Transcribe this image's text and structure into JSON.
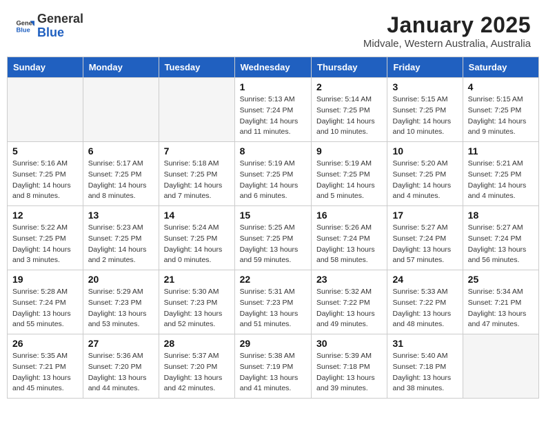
{
  "header": {
    "logo_general": "General",
    "logo_blue": "Blue",
    "month": "January 2025",
    "location": "Midvale, Western Australia, Australia"
  },
  "weekdays": [
    "Sunday",
    "Monday",
    "Tuesday",
    "Wednesday",
    "Thursday",
    "Friday",
    "Saturday"
  ],
  "weeks": [
    [
      {
        "day": "",
        "sunrise": "",
        "sunset": "",
        "daylight": "",
        "empty": true
      },
      {
        "day": "",
        "sunrise": "",
        "sunset": "",
        "daylight": "",
        "empty": true
      },
      {
        "day": "",
        "sunrise": "",
        "sunset": "",
        "daylight": "",
        "empty": true
      },
      {
        "day": "1",
        "sunrise": "Sunrise: 5:13 AM",
        "sunset": "Sunset: 7:24 PM",
        "daylight": "Daylight: 14 hours and 11 minutes.",
        "empty": false
      },
      {
        "day": "2",
        "sunrise": "Sunrise: 5:14 AM",
        "sunset": "Sunset: 7:25 PM",
        "daylight": "Daylight: 14 hours and 10 minutes.",
        "empty": false
      },
      {
        "day": "3",
        "sunrise": "Sunrise: 5:15 AM",
        "sunset": "Sunset: 7:25 PM",
        "daylight": "Daylight: 14 hours and 10 minutes.",
        "empty": false
      },
      {
        "day": "4",
        "sunrise": "Sunrise: 5:15 AM",
        "sunset": "Sunset: 7:25 PM",
        "daylight": "Daylight: 14 hours and 9 minutes.",
        "empty": false
      }
    ],
    [
      {
        "day": "5",
        "sunrise": "Sunrise: 5:16 AM",
        "sunset": "Sunset: 7:25 PM",
        "daylight": "Daylight: 14 hours and 8 minutes.",
        "empty": false
      },
      {
        "day": "6",
        "sunrise": "Sunrise: 5:17 AM",
        "sunset": "Sunset: 7:25 PM",
        "daylight": "Daylight: 14 hours and 8 minutes.",
        "empty": false
      },
      {
        "day": "7",
        "sunrise": "Sunrise: 5:18 AM",
        "sunset": "Sunset: 7:25 PM",
        "daylight": "Daylight: 14 hours and 7 minutes.",
        "empty": false
      },
      {
        "day": "8",
        "sunrise": "Sunrise: 5:19 AM",
        "sunset": "Sunset: 7:25 PM",
        "daylight": "Daylight: 14 hours and 6 minutes.",
        "empty": false
      },
      {
        "day": "9",
        "sunrise": "Sunrise: 5:19 AM",
        "sunset": "Sunset: 7:25 PM",
        "daylight": "Daylight: 14 hours and 5 minutes.",
        "empty": false
      },
      {
        "day": "10",
        "sunrise": "Sunrise: 5:20 AM",
        "sunset": "Sunset: 7:25 PM",
        "daylight": "Daylight: 14 hours and 4 minutes.",
        "empty": false
      },
      {
        "day": "11",
        "sunrise": "Sunrise: 5:21 AM",
        "sunset": "Sunset: 7:25 PM",
        "daylight": "Daylight: 14 hours and 4 minutes.",
        "empty": false
      }
    ],
    [
      {
        "day": "12",
        "sunrise": "Sunrise: 5:22 AM",
        "sunset": "Sunset: 7:25 PM",
        "daylight": "Daylight: 14 hours and 3 minutes.",
        "empty": false
      },
      {
        "day": "13",
        "sunrise": "Sunrise: 5:23 AM",
        "sunset": "Sunset: 7:25 PM",
        "daylight": "Daylight: 14 hours and 2 minutes.",
        "empty": false
      },
      {
        "day": "14",
        "sunrise": "Sunrise: 5:24 AM",
        "sunset": "Sunset: 7:25 PM",
        "daylight": "Daylight: 14 hours and 0 minutes.",
        "empty": false
      },
      {
        "day": "15",
        "sunrise": "Sunrise: 5:25 AM",
        "sunset": "Sunset: 7:25 PM",
        "daylight": "Daylight: 13 hours and 59 minutes.",
        "empty": false
      },
      {
        "day": "16",
        "sunrise": "Sunrise: 5:26 AM",
        "sunset": "Sunset: 7:24 PM",
        "daylight": "Daylight: 13 hours and 58 minutes.",
        "empty": false
      },
      {
        "day": "17",
        "sunrise": "Sunrise: 5:27 AM",
        "sunset": "Sunset: 7:24 PM",
        "daylight": "Daylight: 13 hours and 57 minutes.",
        "empty": false
      },
      {
        "day": "18",
        "sunrise": "Sunrise: 5:27 AM",
        "sunset": "Sunset: 7:24 PM",
        "daylight": "Daylight: 13 hours and 56 minutes.",
        "empty": false
      }
    ],
    [
      {
        "day": "19",
        "sunrise": "Sunrise: 5:28 AM",
        "sunset": "Sunset: 7:24 PM",
        "daylight": "Daylight: 13 hours and 55 minutes.",
        "empty": false
      },
      {
        "day": "20",
        "sunrise": "Sunrise: 5:29 AM",
        "sunset": "Sunset: 7:23 PM",
        "daylight": "Daylight: 13 hours and 53 minutes.",
        "empty": false
      },
      {
        "day": "21",
        "sunrise": "Sunrise: 5:30 AM",
        "sunset": "Sunset: 7:23 PM",
        "daylight": "Daylight: 13 hours and 52 minutes.",
        "empty": false
      },
      {
        "day": "22",
        "sunrise": "Sunrise: 5:31 AM",
        "sunset": "Sunset: 7:23 PM",
        "daylight": "Daylight: 13 hours and 51 minutes.",
        "empty": false
      },
      {
        "day": "23",
        "sunrise": "Sunrise: 5:32 AM",
        "sunset": "Sunset: 7:22 PM",
        "daylight": "Daylight: 13 hours and 49 minutes.",
        "empty": false
      },
      {
        "day": "24",
        "sunrise": "Sunrise: 5:33 AM",
        "sunset": "Sunset: 7:22 PM",
        "daylight": "Daylight: 13 hours and 48 minutes.",
        "empty": false
      },
      {
        "day": "25",
        "sunrise": "Sunrise: 5:34 AM",
        "sunset": "Sunset: 7:21 PM",
        "daylight": "Daylight: 13 hours and 47 minutes.",
        "empty": false
      }
    ],
    [
      {
        "day": "26",
        "sunrise": "Sunrise: 5:35 AM",
        "sunset": "Sunset: 7:21 PM",
        "daylight": "Daylight: 13 hours and 45 minutes.",
        "empty": false
      },
      {
        "day": "27",
        "sunrise": "Sunrise: 5:36 AM",
        "sunset": "Sunset: 7:20 PM",
        "daylight": "Daylight: 13 hours and 44 minutes.",
        "empty": false
      },
      {
        "day": "28",
        "sunrise": "Sunrise: 5:37 AM",
        "sunset": "Sunset: 7:20 PM",
        "daylight": "Daylight: 13 hours and 42 minutes.",
        "empty": false
      },
      {
        "day": "29",
        "sunrise": "Sunrise: 5:38 AM",
        "sunset": "Sunset: 7:19 PM",
        "daylight": "Daylight: 13 hours and 41 minutes.",
        "empty": false
      },
      {
        "day": "30",
        "sunrise": "Sunrise: 5:39 AM",
        "sunset": "Sunset: 7:18 PM",
        "daylight": "Daylight: 13 hours and 39 minutes.",
        "empty": false
      },
      {
        "day": "31",
        "sunrise": "Sunrise: 5:40 AM",
        "sunset": "Sunset: 7:18 PM",
        "daylight": "Daylight: 13 hours and 38 minutes.",
        "empty": false
      },
      {
        "day": "",
        "sunrise": "",
        "sunset": "",
        "daylight": "",
        "empty": true
      }
    ]
  ]
}
